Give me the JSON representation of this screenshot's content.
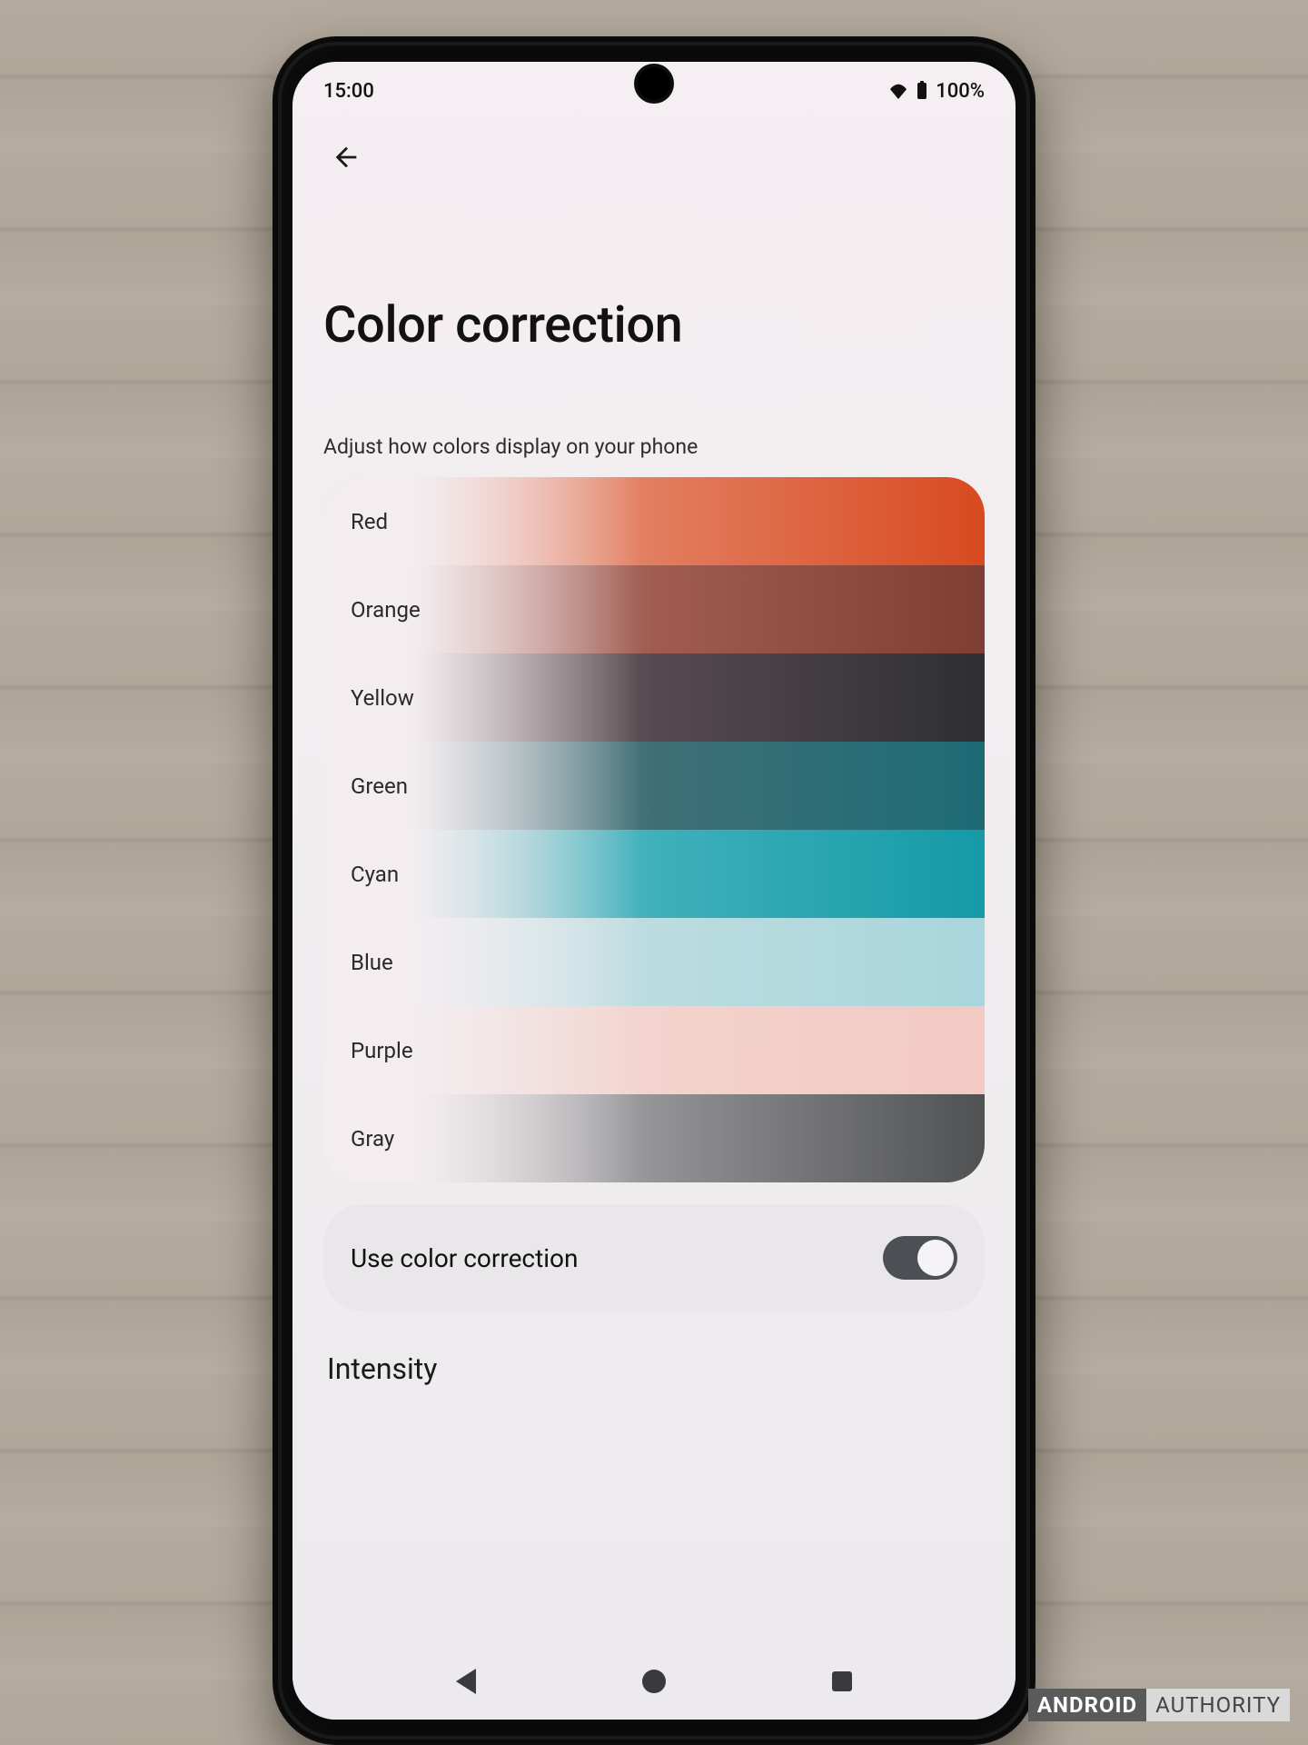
{
  "status": {
    "time": "15:00",
    "battery_pct": "100%"
  },
  "page": {
    "title": "Color correction",
    "subtitle": "Adjust how colors display on your phone"
  },
  "palette": [
    {
      "label": "Red"
    },
    {
      "label": "Orange"
    },
    {
      "label": "Yellow"
    },
    {
      "label": "Green"
    },
    {
      "label": "Cyan"
    },
    {
      "label": "Blue"
    },
    {
      "label": "Purple"
    },
    {
      "label": "Gray"
    }
  ],
  "toggle": {
    "label": "Use color correction",
    "on": true
  },
  "section": {
    "intensity": "Intensity"
  },
  "watermark": {
    "a": "ANDROID",
    "b": "AUTHORITY"
  }
}
